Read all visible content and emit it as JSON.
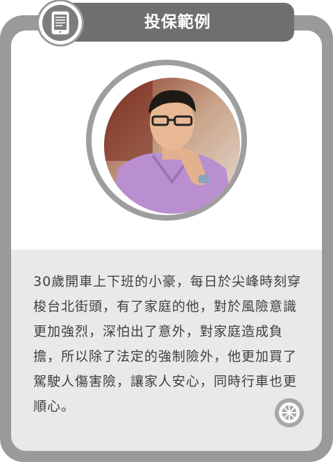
{
  "header": {
    "title": "投保範例",
    "icon": "tablet-icon"
  },
  "portrait": {
    "description_icon": "person-photo"
  },
  "story": {
    "text": "30歲開車上下班的小豪，每日於尖峰時刻穿梭台北街頭，有了家庭的他，對於風險意識更加強烈，深怕出了意外，對家庭造成負擔，所以除了法定的強制險外，他更加買了駕駛人傷害險，讓家人安心，同時行車也更順心。"
  },
  "footer": {
    "icon": "wheel-icon"
  },
  "colors": {
    "frame": "#9a9a9a",
    "title_bar": "#6f6f6f",
    "text_panel": "#e9e9e9",
    "text": "#3f3f3f"
  }
}
